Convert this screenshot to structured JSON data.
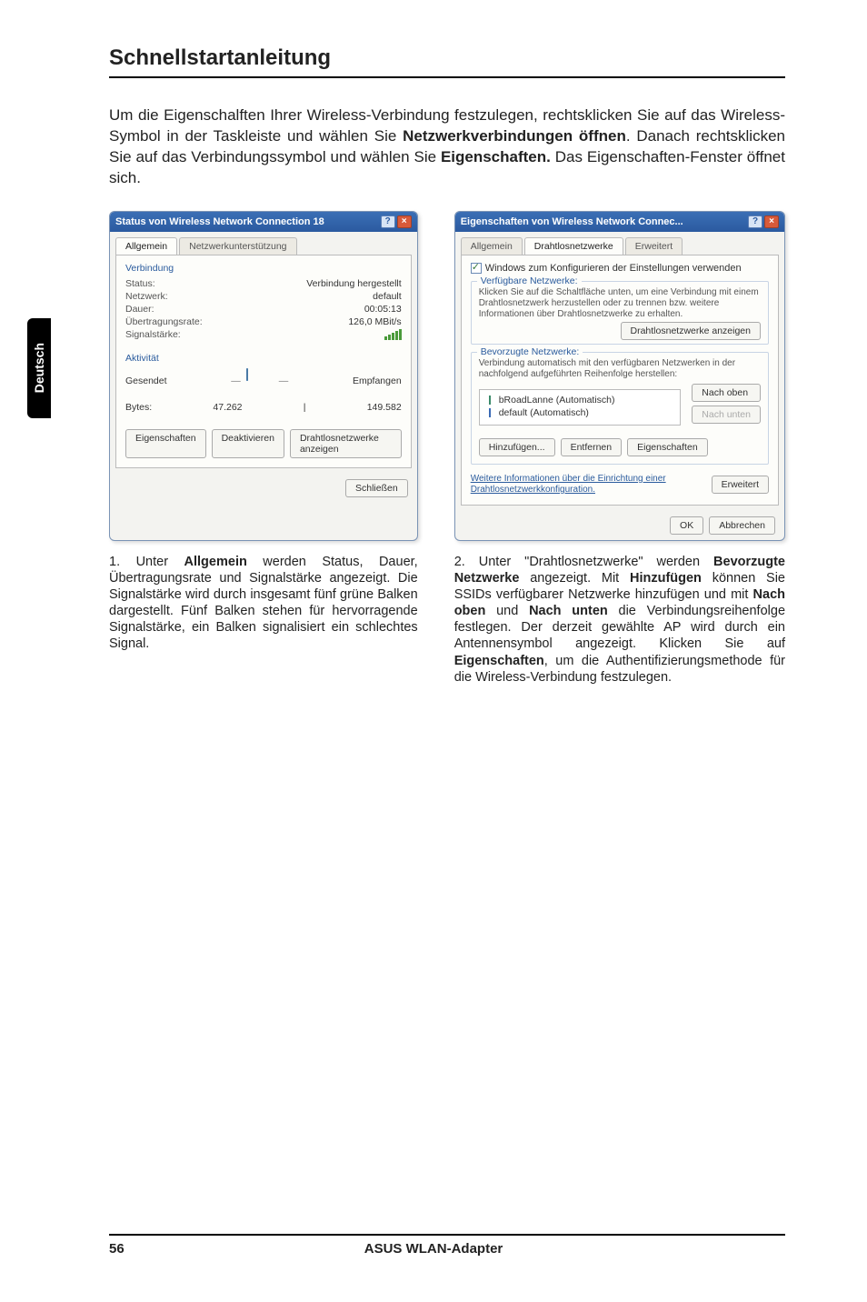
{
  "header": {
    "title": "Schnellstartanleitung"
  },
  "side_tab": "Deutsch",
  "intro": {
    "p1_a": "Um die Eigenschalften Ihrer Wireless-Verbindung festzulegen, rechtsklicken Sie auf das Wireless-Symbol in der Taskleiste und wählen Sie ",
    "p1_b1": "Netzwerkverbindungen öffnen",
    "p1_c": ". Danach rechtsklicken Sie auf das Verbindungssymbol und wählen Sie ",
    "p1_b2": "Eigenschaften.",
    "p1_d": " Das Eigenschaften-Fenster öffnet sich."
  },
  "dialog1": {
    "title": "Status von Wireless Network Connection 18",
    "tabs": [
      "Allgemein",
      "Netzwerkunterstützung"
    ],
    "group_conn": "Verbindung",
    "rows": {
      "status_k": "Status:",
      "status_v": "Verbindung hergestellt",
      "net_k": "Netzwerk:",
      "net_v": "default",
      "dur_k": "Dauer:",
      "dur_v": "00:05:13",
      "rate_k": "Übertragungsrate:",
      "rate_v": "126,0 MBit/s",
      "sig_k": "Signalstärke:"
    },
    "group_act": "Aktivität",
    "act_sent": "Gesendet",
    "act_recv": "Empfangen",
    "bytes_label": "Bytes:",
    "bytes_sent": "47.262",
    "bytes_recv": "149.582",
    "btns": {
      "props": "Eigenschaften",
      "disable": "Deaktivieren",
      "view": "Drahtlosnetzwerke anzeigen"
    },
    "close": "Schließen"
  },
  "dialog2": {
    "title": "Eigenschaften von Wireless Network Connec...",
    "tabs": [
      "Allgemein",
      "Drahtlosnetzwerke",
      "Erweitert"
    ],
    "chk_label": "Windows zum Konfigurieren der Einstellungen verwenden",
    "grp_avail": "Verfügbare Netzwerke:",
    "avail_help": "Klicken Sie auf die Schaltfläche unten, um eine Verbindung mit einem Drahtlosnetzwerk herzustellen oder zu trennen bzw. weitere Informationen über Drahtlosnetzwerke zu erhalten.",
    "btn_view": "Drahtlosnetzwerke anzeigen",
    "grp_pref": "Bevorzugte Netzwerke:",
    "pref_help": "Verbindung automatisch mit den verfügbaren Netzwerken in der nachfolgend aufgeführten Reihenfolge herstellen:",
    "items": [
      "bRoadLanne (Automatisch)",
      "default (Automatisch)"
    ],
    "btn_up": "Nach oben",
    "btn_down": "Nach unten",
    "btn_add": "Hinzufügen...",
    "btn_remove": "Entfernen",
    "btn_props": "Eigenschaften",
    "adv_help": "Weitere Informationen über die Einrichtung einer Drahtlosnetzwerkkonfiguration.",
    "btn_adv": "Erweitert",
    "ok": "OK",
    "cancel": "Abbrechen"
  },
  "captions": {
    "c1_num": "1. ",
    "c1_a": "Unter ",
    "c1_b1": "Allgemein",
    "c1_c": " werden Status, Dauer, Übertragungsrate und Signalstärke angezeigt. Die Signalstärke wird durch insgesamt fünf grüne Balken dargestellt. Fünf Balken stehen für hervorragende Signalstärke, ein Balken signalisiert ein schlechtes Signal.",
    "c2_num": "2. ",
    "c2_a": "Unter \"Drahtlosnetzwerke\" werden ",
    "c2_b1": "Bevorzugte Netzwerke",
    "c2_c": " angezeigt. Mit ",
    "c2_b2": "Hinzufügen",
    "c2_d": " können Sie SSIDs verfügbarer Netzwerke hinzufügen und mit ",
    "c2_b3": "Nach oben",
    "c2_e": " und ",
    "c2_b4": "Nach unten",
    "c2_f": " die Verbindungsreihenfolge festlegen. Der derzeit gewählte AP wird durch ein Antennensymbol angezeigt.  Klicken Sie auf ",
    "c2_b5": "Eigenschaften",
    "c2_g": ", um die Authentifizierungsmethode für die Wireless-Verbindung festzulegen."
  },
  "footer": {
    "page": "56",
    "product": "ASUS WLAN-Adapter"
  }
}
